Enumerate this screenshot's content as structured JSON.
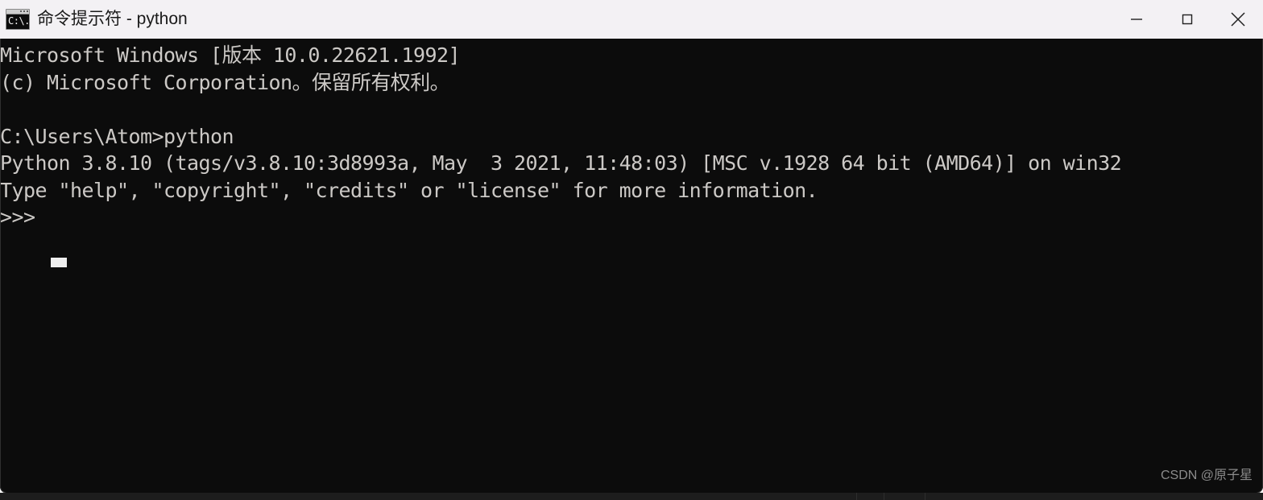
{
  "window": {
    "title": "命令提示符 - python",
    "icon_name": "cmd-icon",
    "icon_text": "C:\\.",
    "background_color": "#0c0c0c",
    "titlebar_color": "#f3f1f4",
    "text_color": "#ccc9c6"
  },
  "controls": {
    "minimize_label": "最小化",
    "maximize_label": "最大化",
    "close_label": "关闭"
  },
  "terminal": {
    "lines": [
      "Microsoft Windows [版本 10.0.22621.1992]",
      "(c) Microsoft Corporation。保留所有权利。",
      "",
      "C:\\Users\\Atom>python",
      "Python 3.8.10 (tags/v3.8.10:3d8993a, May  3 2021, 11:48:03) [MSC v.1928 64 bit (AMD64)] on win32",
      "Type \"help\", \"copyright\", \"credits\" or \"license\" for more information.",
      ">>>"
    ],
    "full_text": "Microsoft Windows [版本 10.0.22621.1992]\n(c) Microsoft Corporation。保留所有权利。\n\nC:\\Users\\Atom>python\nPython 3.8.10 (tags/v3.8.10:3d8993a, May  3 2021, 11:48:03) [MSC v.1928 64 bit (AMD64)] on win32\nType \"help\", \"copyright\", \"credits\" or \"license\" for more information.\n>>>",
    "prompt": ">>>",
    "cursor_visible": true
  },
  "watermark": {
    "text": "CSDN @原子星"
  }
}
